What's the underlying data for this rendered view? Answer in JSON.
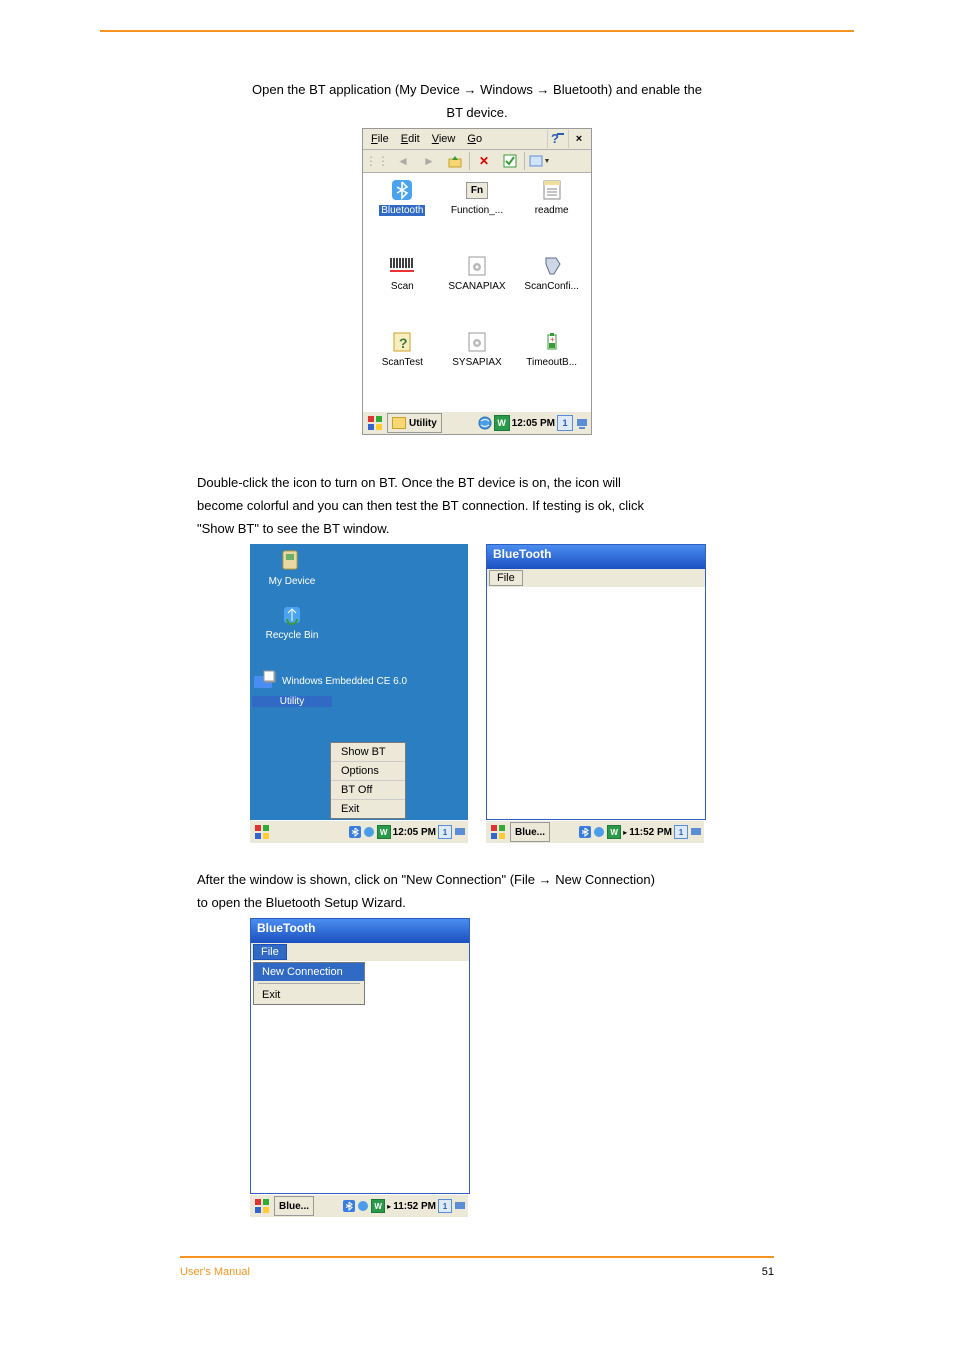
{
  "page": {
    "header_line1": "Open the BT application (My Device → Windows → Bluetooth) and enable the",
    "header_line2": "BT device.",
    "middle_line": "Double-click the icon to turn on BT. Once the BT device is on, the icon will",
    "middle_line_b": "become colorful and you can then test the BT connection. If testing is ok, click",
    "middle_line_c": "\"Show BT\" to see the BT window.",
    "lower_line": "After the window is shown, click on \"New Connection\" (File → New Connection)",
    "lower_line_b": "to open the Bluetooth Setup Wizard.",
    "footer_label": "User's Manual",
    "footer_page": "51"
  },
  "explorer": {
    "menus": [
      "File",
      "Edit",
      "View",
      "Go"
    ],
    "help_glyph": "?",
    "close_glyph": "×",
    "icons": [
      {
        "name": "Bluetooth",
        "selected": true
      },
      {
        "name": "Function_...",
        "selected": false
      },
      {
        "name": "readme",
        "selected": false
      },
      {
        "name": "Scan",
        "selected": false
      },
      {
        "name": "SCANAPIAX",
        "selected": false
      },
      {
        "name": "ScanConfi...",
        "selected": false
      },
      {
        "name": "ScanTest",
        "selected": false
      },
      {
        "name": "SYSAPIAX",
        "selected": false
      },
      {
        "name": "TimeoutB...",
        "selected": false
      }
    ],
    "task_label": "Utility",
    "clock": "12:05 PM"
  },
  "desktop": {
    "icons": [
      {
        "name": "My Device"
      },
      {
        "name": "Recycle Bin"
      },
      {
        "name": "Windows Embedded CE 6.0"
      },
      {
        "name": "Utility"
      }
    ],
    "context_menu": [
      "Show BT",
      "Options",
      "BT Off",
      "Exit"
    ],
    "clock": "12:05 PM"
  },
  "bt_window": {
    "title": "BlueTooth",
    "menu_file": "File",
    "task_label": "Blue...",
    "clock": "11:52 PM"
  },
  "bt_window_dd": {
    "title": "BlueTooth",
    "menu_file": "File",
    "items": [
      "New Connection",
      "Exit"
    ],
    "task_label": "Blue...",
    "clock": "11:52 PM"
  },
  "tray": {
    "one": "1",
    "w": "W"
  }
}
